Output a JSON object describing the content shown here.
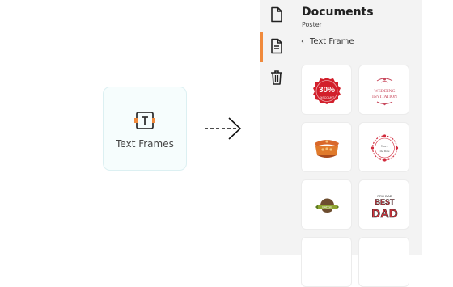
{
  "card": {
    "label": "Text Frames",
    "icon": "text-frame-icon"
  },
  "panel": {
    "title": "Documents",
    "subtitle": "Poster",
    "breadcrumb": "Text Frame",
    "rail": [
      {
        "name": "document-icon",
        "active": false
      },
      {
        "name": "text-document-icon",
        "active": true
      },
      {
        "name": "trash-icon",
        "active": false
      }
    ],
    "accent": "#f08a3c",
    "templates": [
      {
        "name": "discount-badge-template",
        "badge_big": "30%",
        "badge_small": "DISCOUNT",
        "color": "#d21f2b"
      },
      {
        "name": "wedding-invitation-template",
        "line1": "WEDDING",
        "line2": "INVITATION",
        "color": "#c7475b"
      },
      {
        "name": "ornate-frame-orange-template",
        "color": "#e07a2b"
      },
      {
        "name": "floral-wreath-template",
        "line1": "Save",
        "line2": "the Date",
        "color": "#d12a3c"
      },
      {
        "name": "seal-badge-template",
        "text": "BADGE",
        "color": "#6d4d2f"
      },
      {
        "name": "best-dad-template",
        "line1": "PRO DAD",
        "line2": "BEST",
        "line3": "DAD",
        "color": "#d8343d"
      }
    ]
  }
}
